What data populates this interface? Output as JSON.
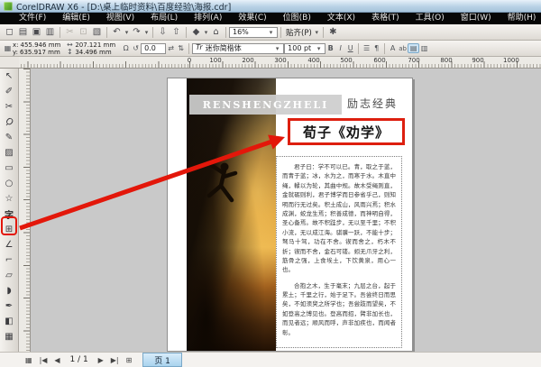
{
  "window": {
    "title": "CorelDRAW X6 - [D:\\桌上临时资料\\百度经验\\海报.cdr]"
  },
  "menubar": {
    "items": [
      {
        "label": "文件(F)"
      },
      {
        "label": "编辑(E)"
      },
      {
        "label": "视图(V)"
      },
      {
        "label": "布局(L)"
      },
      {
        "label": "排列(A)"
      },
      {
        "label": "效果(C)"
      },
      {
        "label": "位图(B)"
      },
      {
        "label": "文本(X)"
      },
      {
        "label": "表格(T)"
      },
      {
        "label": "工具(O)"
      },
      {
        "label": "窗口(W)"
      },
      {
        "label": "帮助(H)"
      }
    ]
  },
  "toolbar": {
    "caret": "▾",
    "zoom_value": "16%",
    "snap_label": "贴齐(P)",
    "icons": [
      {
        "name": "new",
        "glyph": "◻"
      },
      {
        "name": "open",
        "glyph": "▤"
      },
      {
        "name": "save",
        "glyph": "▣"
      },
      {
        "name": "print",
        "glyph": "▥"
      },
      {
        "name": "cut",
        "glyph": "✂"
      },
      {
        "name": "copy",
        "glyph": "⊡"
      },
      {
        "name": "paste",
        "glyph": "▧"
      },
      {
        "name": "undo",
        "glyph": "↶"
      },
      {
        "name": "redo",
        "glyph": "↷"
      },
      {
        "name": "import",
        "glyph": "⇩"
      },
      {
        "name": "export",
        "glyph": "⇧"
      },
      {
        "name": "app-launcher",
        "glyph": "◆"
      },
      {
        "name": "welcome-screen",
        "glyph": "⌂"
      },
      {
        "name": "options",
        "glyph": "✱"
      }
    ]
  },
  "propbar": {
    "position_icon": "▦",
    "x_label": "x:",
    "x_value": "455.946 mm",
    "y_label": "y:",
    "y_value": "635.917 mm",
    "width_icon": "↔",
    "width_value": "207.121 mm",
    "height_icon": "↕",
    "height_value": "34.496 mm",
    "lock_icon": "Ω",
    "rotate_icon": "↺",
    "rotation_value": "0.0",
    "mirror_h_icon": "⇄",
    "mirror_v_icon": "⇅",
    "font_preview": "Tr",
    "font_name": "迷你简楷体",
    "font_size": "100 pt",
    "bold": "B",
    "italic": "I",
    "underline": "U",
    "bullet_icon": "☰",
    "dropcap_icon": "¶",
    "charformat_icon": "A",
    "edittext_icon": "ab",
    "htext_icon": "▤",
    "vtext_icon": "▥"
  },
  "ruler": {
    "labels": [
      "0",
      "100",
      "200",
      "300",
      "400",
      "500",
      "600",
      "700",
      "800",
      "900",
      "1000"
    ]
  },
  "toolbox": {
    "items": [
      {
        "name": "pick-tool",
        "glyph": "↖"
      },
      {
        "name": "shape-tool",
        "glyph": "✐"
      },
      {
        "name": "crop-tool",
        "glyph": "✂"
      },
      {
        "name": "zoom-tool",
        "glyph": "Ϙ"
      },
      {
        "name": "freehand-tool",
        "glyph": "✎"
      },
      {
        "name": "smart-fill-tool",
        "glyph": "▨"
      },
      {
        "name": "rectangle-tool",
        "glyph": "▭"
      },
      {
        "name": "ellipse-tool",
        "glyph": "○"
      },
      {
        "name": "polygon-tool",
        "glyph": "☆"
      },
      {
        "name": "text-tool",
        "glyph": "字"
      },
      {
        "name": "table-tool",
        "glyph": "⊞"
      },
      {
        "name": "dimension-tool",
        "glyph": "∠"
      },
      {
        "name": "connector-tool",
        "glyph": "⌐"
      },
      {
        "name": "blend-tool",
        "glyph": "▱"
      },
      {
        "name": "eyedropper-tool",
        "glyph": "◗"
      },
      {
        "name": "outline-pen-tool",
        "glyph": "✒"
      },
      {
        "name": "fill-tool",
        "glyph": "◧"
      },
      {
        "name": "interactive-fill-tool",
        "glyph": "▦"
      }
    ]
  },
  "poster": {
    "band_text": "RENSHENGZHELI",
    "tagline": "励志经典",
    "title": "荀子《劝学》",
    "p1": "君子曰：学不可以已。青，取之于蓝，而青于蓝；冰，水为之，而寒于水。木直中绳，輮以为轮，其曲中规。故木受绳则直，金就砺则利，君子博学而日参省乎己，则知明而行无过矣。积土成山，风雨兴焉；积水成渊，蛟龙生焉；积善成德，而神明自得，圣心备焉。故不积跬步，无以至千里；不积小流，无以成江海。骐骥一跃，不能十步；驽马十驾，功在不舍。锲而舍之，朽木不折；锲而不舍，金石可镂。蚓无爪牙之利，筋骨之强，上食埃土，下饮黄泉，用心一也。",
    "p2": "合抱之木，生于毫末；九层之台，起于累土；千里之行，始于足下。吾尝终日而思矣，不如须臾之所学也；吾尝跂而望矣，不如登高之博见也。登高而招，臂非加长也，而见者远；顺风而呼，声非加疾也，而闻者彰。"
  },
  "nav": {
    "page_sorter_icon": "▦",
    "first_icon": "|◀",
    "prev_icon": "◀",
    "page_indicator": "1 / 1",
    "next_icon": "▶",
    "last_icon": "▶|",
    "add_page_icon": "⊞",
    "page_tab": "页 1"
  },
  "colors": {
    "annotation_red": "#e3170a",
    "tab_blue": "#a9d3ee",
    "menubar_black": "#070707"
  }
}
